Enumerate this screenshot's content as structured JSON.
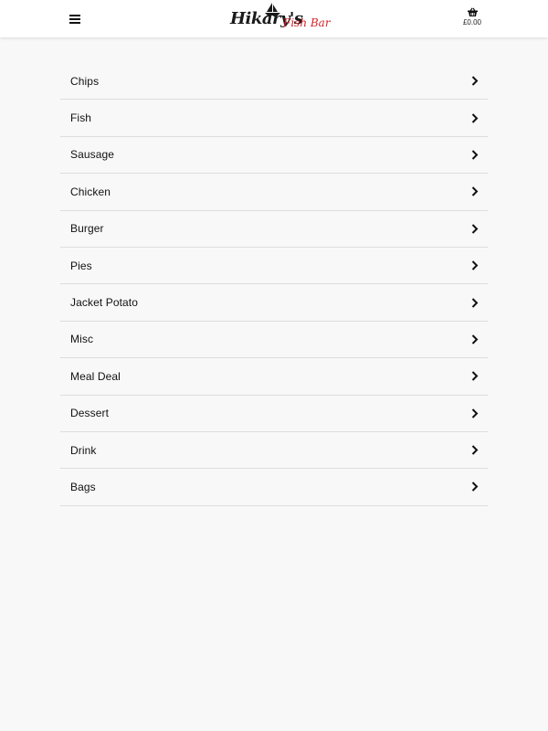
{
  "header": {
    "menu_icon": "hamburger-menu-icon",
    "logo": {
      "name": "Hikary's",
      "tagline": "Fish Bar",
      "brand_color": "#d8232a"
    },
    "cart": {
      "icon": "basket-icon",
      "total": "£0.00"
    }
  },
  "categories": [
    {
      "label": "Chips",
      "icon": "chevron-right-icon"
    },
    {
      "label": "Fish",
      "icon": "chevron-right-icon"
    },
    {
      "label": "Sausage",
      "icon": "chevron-right-icon"
    },
    {
      "label": "Chicken",
      "icon": "chevron-right-icon"
    },
    {
      "label": "Burger",
      "icon": "chevron-right-icon"
    },
    {
      "label": "Pies",
      "icon": "chevron-right-icon"
    },
    {
      "label": "Jacket Potato",
      "icon": "chevron-right-icon"
    },
    {
      "label": "Misc",
      "icon": "chevron-right-icon"
    },
    {
      "label": "Meal Deal",
      "icon": "chevron-right-icon"
    },
    {
      "label": "Dessert",
      "icon": "chevron-right-icon"
    },
    {
      "label": "Drink",
      "icon": "chevron-right-icon"
    },
    {
      "label": "Bags",
      "icon": "chevron-right-icon"
    }
  ],
  "colors": {
    "background": "#f8f8f8",
    "header_background": "#ffffff",
    "divider": "#dddddd",
    "text": "#111111"
  }
}
